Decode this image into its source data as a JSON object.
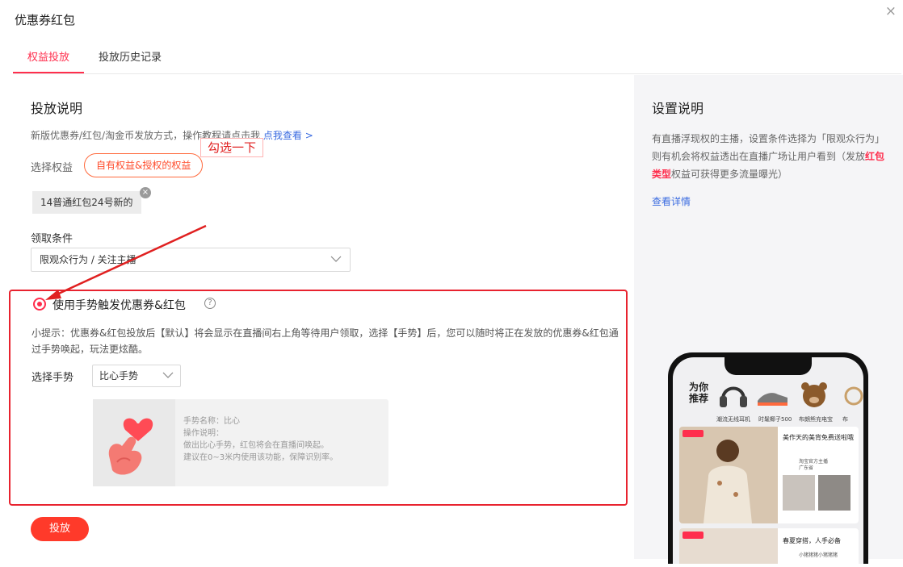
{
  "dialog": {
    "title": "优惠券红包",
    "close": "×"
  },
  "tabs": [
    {
      "label": "权益投放",
      "active": true
    },
    {
      "label": "投放历史记录",
      "active": false
    }
  ],
  "main": {
    "section_title": "投放说明",
    "desc_text": "新版优惠券/红包/淘金币发放方式，操作教程请点击我",
    "desc_link": "点我查看 >",
    "select_benefit_label": "选择权益",
    "benefit_pill": "自有权益&授权的权益",
    "selected_tag": "14普通红包24号新的",
    "annotation": "勾选一下",
    "condition_label": "领取条件",
    "condition_value": "限观众行为 / 关注主播",
    "gesture_box": {
      "checkbox_label": "使用手势触发优惠券&红包",
      "help": "?",
      "tip": "小提示：优惠券&红包投放后【默认】将会显示在直播间右上角等待用户领取，选择【手势】后，您可以随时将正在发放的优惠券&红包通过手势唤起，玩法更炫酷。",
      "gesture_label": "选择手势",
      "gesture_value": "比心手势",
      "card_name": "手势名称：比心",
      "card_op_label": "操作说明：",
      "card_op_1": "做出比心手势，红包将会在直播间唤起。",
      "card_op_2": "建议在0~3米内使用该功能，保障识别率。"
    },
    "submit_label": "投放"
  },
  "side": {
    "title": "设置说明",
    "desc_1": "有直播浮现权的主播，设置条件选择为「限观众行为」则有机会将权益透出在直播广场让用户看到（发放",
    "desc_highlight": "红包类型",
    "desc_2": "权益可获得更多流量曝光）",
    "link": "查看详情",
    "phone": {
      "rec_title": "为你推荐",
      "products": [
        "潮流无线耳机",
        "时髦椰子500",
        "布朗熊充电宝",
        "布"
      ],
      "card1_title": "美作天的美背免费送啦哦",
      "card1_shop": "淘宝官方主播",
      "card1_shop2": "广东省",
      "card2_title": "春夏穿搭，人手必备",
      "card2_shop": "小猪猪猪小猪猪猪"
    }
  },
  "colors": {
    "accent": "#ff2e4d",
    "button": "#ff3a2a",
    "link": "#3a6be0",
    "annot": "#e02020"
  }
}
